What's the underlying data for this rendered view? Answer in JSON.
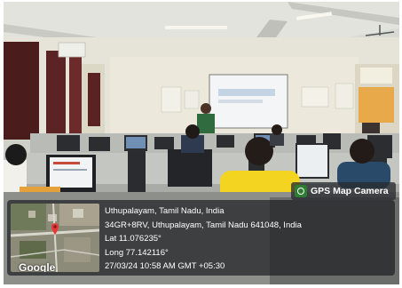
{
  "badge": {
    "label": "GPS Map Camera",
    "icon": "camera-pin-icon"
  },
  "map": {
    "provider": "Google"
  },
  "location": {
    "place": "Uthupalayam, Tamil Nadu, India",
    "address": "34GR+8RV, Uthupalayam, Tamil Nadu 641048, India",
    "latitude": "Lat 11.076235°",
    "longitude": "Long 77.142116°",
    "timestamp": "27/03/24 10:58 AM GMT +05:30"
  },
  "colors": {
    "overlay_bg": "#1e2022",
    "badge_accent": "#2e7d32",
    "text": "#ffffff"
  }
}
